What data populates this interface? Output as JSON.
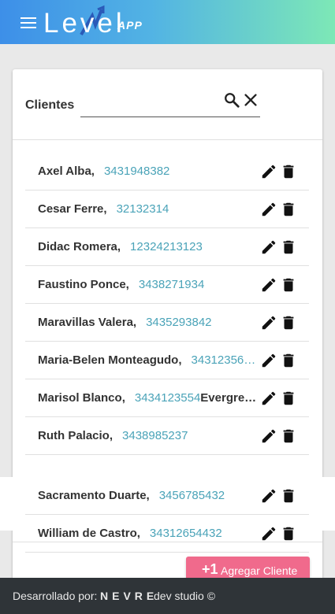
{
  "header": {
    "logo_word": "Level",
    "logo_app": "APP",
    "menu_icon": "menu-icon"
  },
  "clients": {
    "title": "Clientes",
    "search_placeholder": "",
    "clients": [
      {
        "name": "Axel Alba,",
        "phone": "3431948382",
        "extra": ""
      },
      {
        "name": "Cesar Ferre,",
        "phone": "32132314",
        "extra": ""
      },
      {
        "name": "Didac Romera,",
        "phone": "12324213123",
        "extra": ""
      },
      {
        "name": "Faustino Ponce,",
        "phone": "3438271934",
        "extra": ""
      },
      {
        "name": "Maravillas Valera,",
        "phone": "3435293842",
        "extra": ""
      },
      {
        "name": "Maria-Belen Monteagudo,",
        "phone": "34312356…",
        "extra": ""
      },
      {
        "name": "Marisol Blanco,",
        "phone": "3434123554",
        "extra": "Evergre…"
      },
      {
        "name": "Ruth Palacio,",
        "phone": "3438985237",
        "extra": ""
      },
      {
        "name": "Sacramento Duarte,",
        "phone": "3456785432",
        "extra": ""
      },
      {
        "name": "William de Castro,",
        "phone": "34312654432",
        "extra": ""
      }
    ],
    "add_button": {
      "icon": "+1",
      "label": "Agregar Cliente"
    }
  },
  "footer": {
    "developed_by": "Desarrollado por:",
    "brand": "NEVRE",
    "studio": "dev studio ©"
  },
  "colors": {
    "header_gradient": [
      "#3d8fe8",
      "#7de8b6"
    ],
    "phone": "#4aa3b8",
    "accent": "#f06a8c",
    "footer": "#2f3438"
  }
}
